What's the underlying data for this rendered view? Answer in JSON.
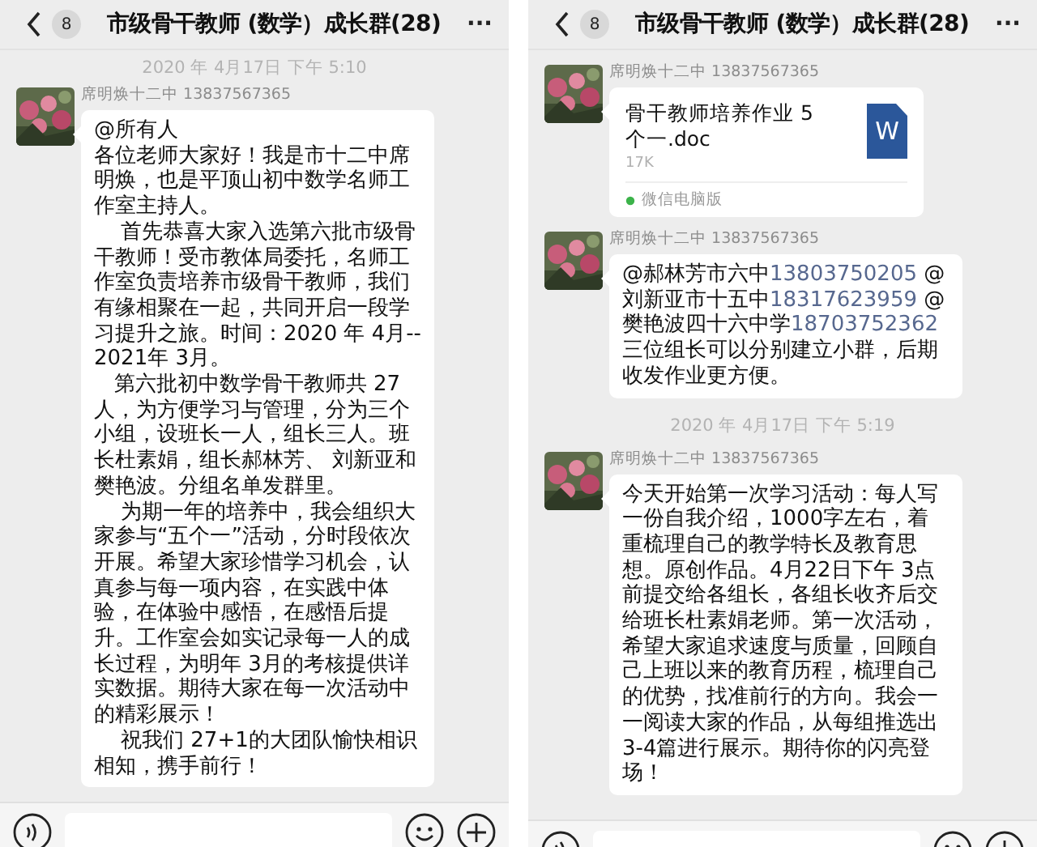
{
  "panels": [
    {
      "header": {
        "unread": "8",
        "title": "市级骨干教师 (数学）成长群(28)",
        "more": "···"
      },
      "messages": [
        {
          "kind": "timestamp",
          "text": "2020 年 4月17日 下午 5:10"
        },
        {
          "kind": "text",
          "sender": "席明焕十二中 13837567365",
          "paragraphs": [
            "@所有人",
            "各位老师大家好！我是市十二中席明焕，也是平顶山初中数学名师工作室主持人。",
            "    首先恭喜大家入选第六批市级骨干教师！受市教体局委托，名师工作室负责培养市级骨干教师，我们有缘相聚在一起，共同开启一段学习提升之旅。时间：2020 年 4月--2021年 3月。",
            "   第六批初中数学骨干教师共 27人，为方便学习与管理，分为三个小组，设班长一人，组长三人。班长杜素娟，组长郝林芳、 刘新亚和樊艳波。分组名单发群里。",
            "    为期一年的培养中，我会组织大家参与“五个一”活动，分时段依次开展。希望大家珍惜学习机会，认真参与每一项内容，在实践中体验，在体验中感悟，在感悟后提升。工作室会如实记录每一人的成长过程，为明年 3月的考核提供详实数据。期待大家在每一次活动中的精彩展示！",
            "    祝我们 27+1的大团队愉快相识相知，携手前行！"
          ]
        }
      ]
    },
    {
      "header": {
        "unread": "8",
        "title": "市级骨干教师 (数学）成长群(28)",
        "more": "···"
      },
      "messages": [
        {
          "kind": "file",
          "sender": "席明焕十二中 13837567365",
          "name": "骨干教师培养作业 5个一.doc",
          "size": "17K",
          "icon_letter": "W",
          "source": "微信电脑版"
        },
        {
          "kind": "mentions",
          "sender": "席明焕十二中 13837567365",
          "segments": [
            {
              "kind": "plain",
              "text": "@郝林芳市六中"
            },
            {
              "kind": "phone",
              "text": "13803750205"
            },
            {
              "kind": "plain",
              "text": " @刘新亚市十五中"
            },
            {
              "kind": "phone",
              "text": "18317623959"
            },
            {
              "kind": "plain",
              "text": " @樊艳波四十六中学"
            },
            {
              "kind": "phone",
              "text": "18703752362"
            },
            {
              "kind": "plain",
              "text": " 三位组长可以分别建立小群，后期收发作业更方便。"
            }
          ]
        },
        {
          "kind": "timestamp",
          "text": "2020 年 4月17日 下午 5:19"
        },
        {
          "kind": "text",
          "sender": "席明焕十二中 13837567365",
          "paragraphs": [
            "今天开始第一次学习活动：每人写一份自我介绍，1000字左右，着重梳理自己的教学特长及教育思想。原创作品。4月22日下午 3点前提交给各组长，各组长收齐后交给班长杜素娟老师。第一次活动，希望大家追求速度与质量，回顾自己上班以来的教育历程，梳理自己的优势，找准前行的方向。我会一一阅读大家的作品，从每组推选出3-4篇进行展示。期待你的闪亮登场！"
          ]
        }
      ]
    }
  ]
}
